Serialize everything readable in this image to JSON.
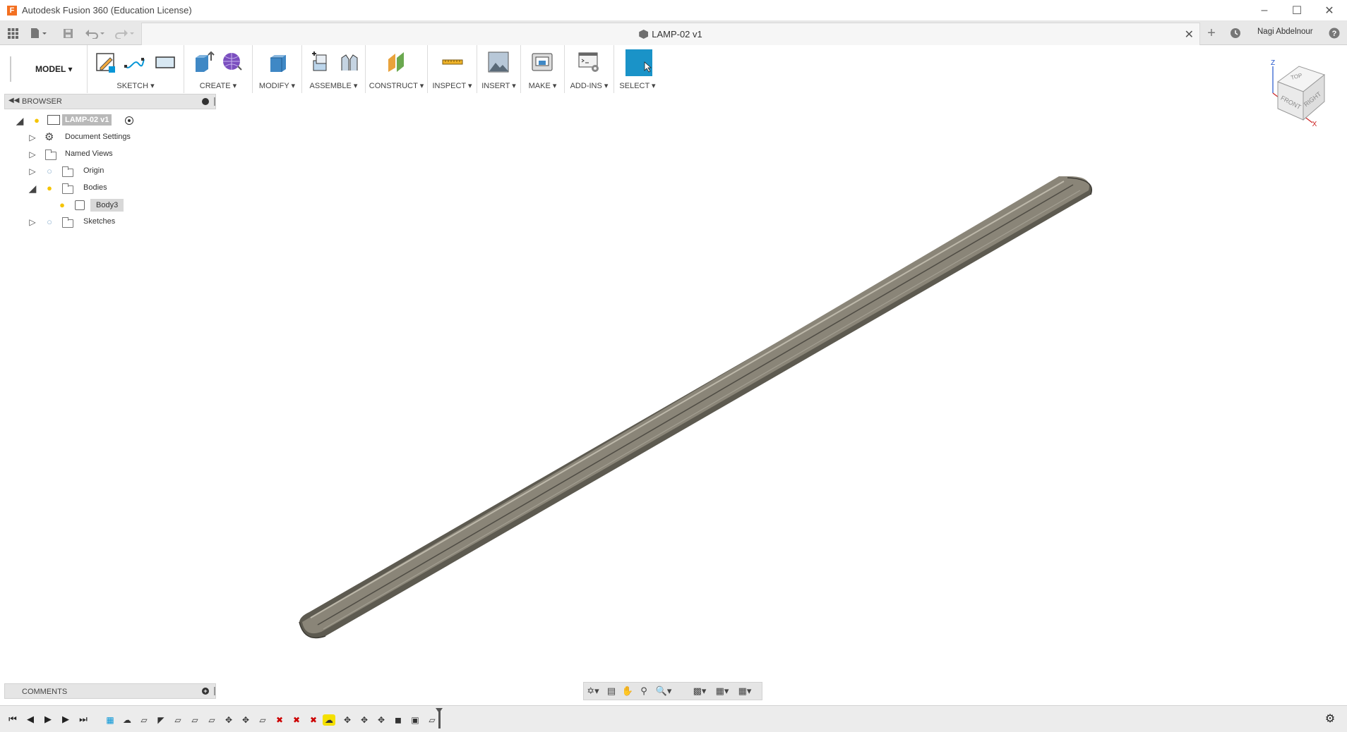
{
  "app": {
    "title": "Autodesk Fusion 360 (Education License)",
    "logo_letter": "F"
  },
  "document": {
    "tab_title": "LAMP-02 v1",
    "user_name": "Nagi Abdelnour"
  },
  "workspace": {
    "label": "MODEL ▾"
  },
  "ribbon": {
    "groups": [
      {
        "label": "SKETCH ▾"
      },
      {
        "label": "CREATE ▾"
      },
      {
        "label": "MODIFY ▾"
      },
      {
        "label": "ASSEMBLE ▾"
      },
      {
        "label": "CONSTRUCT ▾"
      },
      {
        "label": "INSPECT ▾"
      },
      {
        "label": "INSERT ▾"
      },
      {
        "label": "MAKE ▾"
      },
      {
        "label": "ADD-INS ▾"
      },
      {
        "label": "SELECT ▾"
      }
    ]
  },
  "browser": {
    "title": "BROWSER",
    "root": "LAMP-02 v1",
    "nodes": [
      "Document Settings",
      "Named Views",
      "Origin",
      "Bodies",
      "Body3",
      "Sketches"
    ]
  },
  "comments": {
    "title": "COMMENTS"
  },
  "viewcube": {
    "top": "TOP",
    "front": "FRONT",
    "right": "RIGHT",
    "axis_x": "X",
    "axis_z": "Z"
  },
  "colors": {
    "accent": "#0696d7",
    "body": "#6b6659",
    "select_active": "#1a93c8",
    "bulb": "#f5c400",
    "timeline_active": "#f4e000"
  }
}
